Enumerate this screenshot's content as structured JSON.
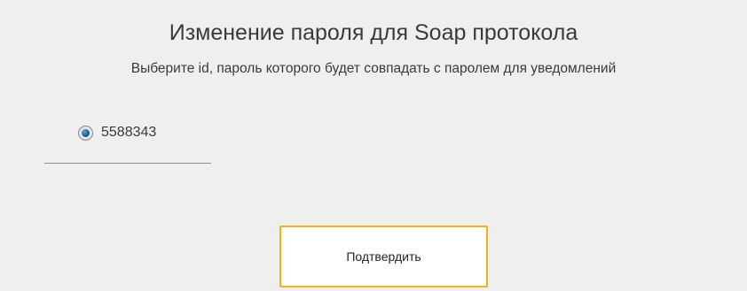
{
  "dialog": {
    "title": "Изменение пароля для Soap протокола",
    "subtitle": "Выберите id, пароль которого будет совпадать с паролем для уведомлений"
  },
  "options": [
    {
      "label": "5588343",
      "selected": true
    }
  ],
  "actions": {
    "confirm_label": "Подтвердить"
  },
  "colors": {
    "background": "#efefef",
    "button_border": "#f0b31b",
    "button_background": "#ffffff",
    "radio_selected": "#1f5f92",
    "text": "#3a3a3a"
  }
}
